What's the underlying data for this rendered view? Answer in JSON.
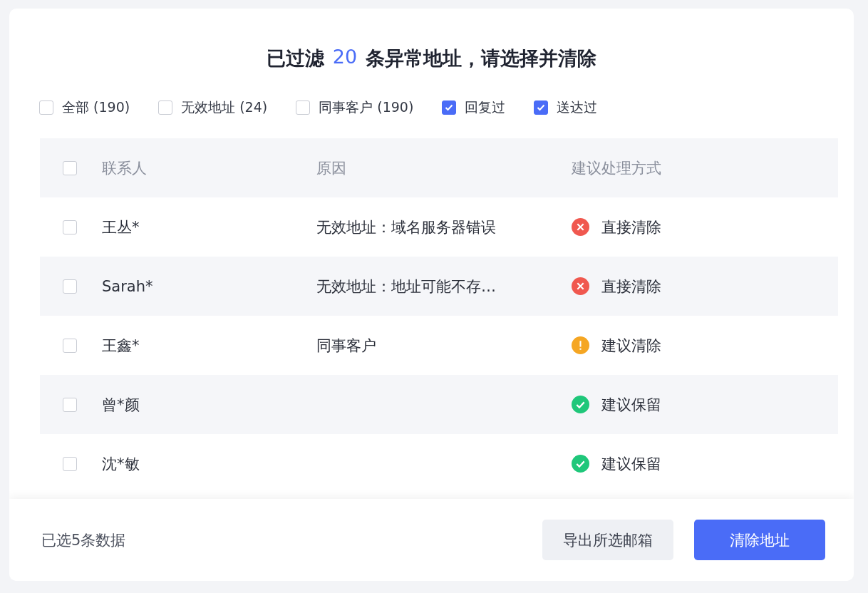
{
  "title": {
    "before": "已过滤",
    "count": "20",
    "after": "条异常地址，请选择并清除"
  },
  "filters": [
    {
      "label": "全部 (190)",
      "checked": false
    },
    {
      "label": "无效地址 (24)",
      "checked": false
    },
    {
      "label": "同事客户 (190)",
      "checked": false
    },
    {
      "label": "回复过",
      "checked": true
    },
    {
      "label": "送达过",
      "checked": true
    }
  ],
  "table": {
    "select_all": {
      "checked": false
    },
    "columns": [
      "联系人",
      "原因",
      "建议处理方式"
    ],
    "rows": [
      {
        "checked": false,
        "contact": "王丛*",
        "reason": "无效地址：域名服务器错误",
        "suggestion": {
          "kind": "remove",
          "text": "直接清除"
        }
      },
      {
        "checked": false,
        "contact": "Sarah*",
        "reason": "无效地址：地址可能不存…",
        "suggestion": {
          "kind": "remove",
          "text": "直接清除"
        }
      },
      {
        "checked": false,
        "contact": "王鑫*",
        "reason": "同事客户",
        "suggestion": {
          "kind": "warn",
          "text": "建议清除"
        }
      },
      {
        "checked": false,
        "contact": "曾*颜",
        "suggestion": {
          "kind": "keep",
          "text": "建议保留"
        }
      },
      {
        "checked": false,
        "contact": "沈*敏",
        "suggestion": {
          "kind": "keep",
          "text": "建议保留"
        }
      }
    ]
  },
  "footer": {
    "summary": "已选5条数据",
    "buttons": [
      {
        "kind": "secondary",
        "label": "导出所选邮箱"
      },
      {
        "kind": "primary",
        "label": "清除地址"
      }
    ]
  }
}
